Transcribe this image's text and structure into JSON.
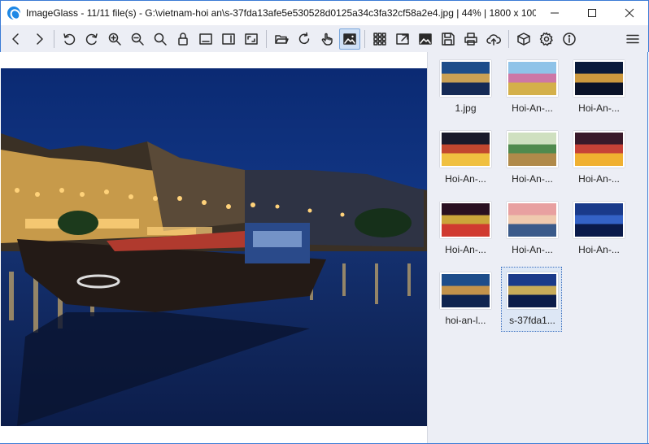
{
  "window": {
    "title": "ImageGlass - 11/11 file(s) - G:\\vietnam-hoi an\\s-37fda13afe5e530528d0125a34c3fa32cf58a2e4.jpg  |  44%  |  1800 x 100...",
    "accent": "#3a7bd5"
  },
  "toolbar": {
    "buttons": [
      {
        "name": "back",
        "icon": "chevron-left-icon"
      },
      {
        "name": "forward",
        "icon": "chevron-right-icon"
      },
      {
        "name": "rotate-left",
        "icon": "rotate-left-icon"
      },
      {
        "name": "rotate-right",
        "icon": "rotate-right-icon"
      },
      {
        "name": "zoom-in",
        "icon": "zoom-in-icon"
      },
      {
        "name": "zoom-out",
        "icon": "zoom-out-icon"
      },
      {
        "name": "actual-size",
        "icon": "magnifier-icon"
      },
      {
        "name": "lock-zoom",
        "icon": "lock-icon"
      },
      {
        "name": "scale-width",
        "icon": "fit-width-icon"
      },
      {
        "name": "scale-height",
        "icon": "fit-height-icon"
      },
      {
        "name": "scale-to-fit",
        "icon": "fit-window-icon"
      },
      {
        "name": "open-file",
        "icon": "folder-open-icon"
      },
      {
        "name": "refresh",
        "icon": "refresh-icon"
      },
      {
        "name": "goto-image",
        "icon": "hand-pointer-icon"
      },
      {
        "name": "thumbnail-bar",
        "icon": "image-icon",
        "active": true
      },
      {
        "name": "checkerboard",
        "icon": "grid-icon"
      },
      {
        "name": "fullscreen",
        "icon": "fullscreen-icon"
      },
      {
        "name": "slideshow",
        "icon": "slideshow-icon"
      },
      {
        "name": "save-as",
        "icon": "save-icon"
      },
      {
        "name": "print",
        "icon": "print-icon"
      },
      {
        "name": "upload",
        "icon": "cloud-upload-icon"
      },
      {
        "name": "extension",
        "icon": "box-icon"
      },
      {
        "name": "settings",
        "icon": "gear-icon"
      },
      {
        "name": "about",
        "icon": "info-icon"
      },
      {
        "name": "main-menu",
        "icon": "hamburger-menu-icon"
      }
    ]
  },
  "thumbnails": [
    {
      "label": "1.jpg",
      "scene": "dusk-river",
      "selected": false
    },
    {
      "label": "Hoi-An-...",
      "scene": "flower-house",
      "selected": false
    },
    {
      "label": "Hoi-An-...",
      "scene": "night-river",
      "selected": false
    },
    {
      "label": "Hoi-An-...",
      "scene": "lantern-street",
      "selected": false
    },
    {
      "label": "Hoi-An-...",
      "scene": "green-street",
      "selected": false
    },
    {
      "label": "Hoi-An-...",
      "scene": "lanterns-shop",
      "selected": false
    },
    {
      "label": "Hoi-An-...",
      "scene": "lanterns-closeup",
      "selected": false
    },
    {
      "label": "Hoi-An-...",
      "scene": "sunset-boats",
      "selected": false
    },
    {
      "label": "Hoi-An-...",
      "scene": "blue-night",
      "selected": false
    },
    {
      "label": "hoi-an-l...",
      "scene": "dusk-river-2",
      "selected": false
    },
    {
      "label": "s-37fda1...",
      "scene": "current",
      "selected": true
    }
  ]
}
